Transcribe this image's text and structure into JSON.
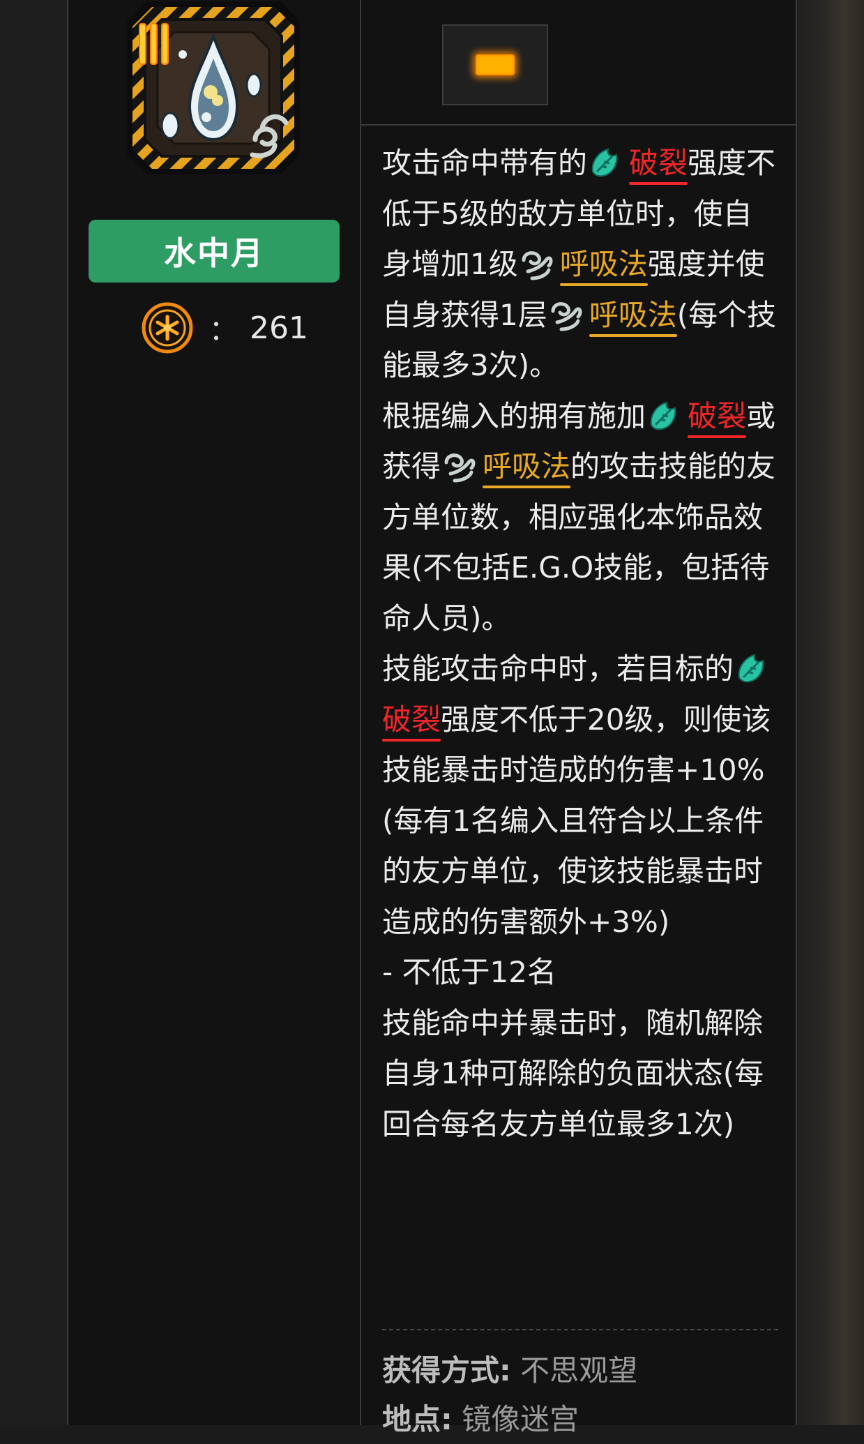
{
  "item": {
    "name": "水中月",
    "cost_separator": "：",
    "cost": "261",
    "tier_numeral": "III"
  },
  "description": {
    "line1_pre": "攻击命中带有的",
    "kw_rupture": "破裂",
    "kw_breath": "呼吸法",
    "line1_post": "强度不低于5级的敌方单位时，使自身增加1级",
    "line2_post": "强度并使自身获得1层",
    "line3_post": "(每个技能最多3次)。",
    "para2_pre": "根据编入的拥有施加",
    "para2_mid": "或获得",
    "para2_post": "的攻击技能的友方单位数，相应强化本饰品效果(不包括E.G.O技能，包括待命人员)。",
    "para3_pre": "技能攻击命中时，若目标的",
    "para3_post": "强度不低于20级，则使该技能暴击时造成的伤害+10%(每有1名编入且符合以上条件的友方单位，使该技能暴击时造成的伤害额外+3%)",
    "para4": "- 不低于12名",
    "para5": "技能命中并暴击时，随机解除自身1种可解除的负面状态(每回合每名友方单位最多1次)"
  },
  "acquisition": {
    "method_label": "获得方式:",
    "method_value": "不思观望",
    "location_label": "地点:",
    "location_value": "镜像迷宫"
  },
  "colors": {
    "name_badge": "#2e9d64",
    "rupture": "#f0262a",
    "breath": "#e8a827",
    "tier": "#ffb300"
  },
  "icons": [
    "water-drop-gift-icon",
    "cost-cog-icon",
    "rupture-icon",
    "breath-icon",
    "tier-indicator"
  ]
}
